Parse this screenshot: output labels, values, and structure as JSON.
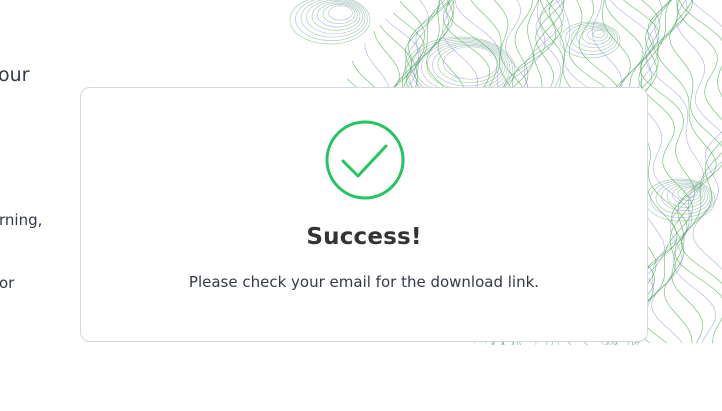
{
  "background": {
    "text_fragments": [
      "our",
      "rning,",
      "or"
    ]
  },
  "modal": {
    "icon": "check-circle-icon",
    "title": "Success!",
    "message": "Please check your email for the download link."
  },
  "colors": {
    "success_green": "#22c55e",
    "art_green": "#4caf50",
    "art_blue": "#7a84c4",
    "text_dark": "#333333"
  }
}
